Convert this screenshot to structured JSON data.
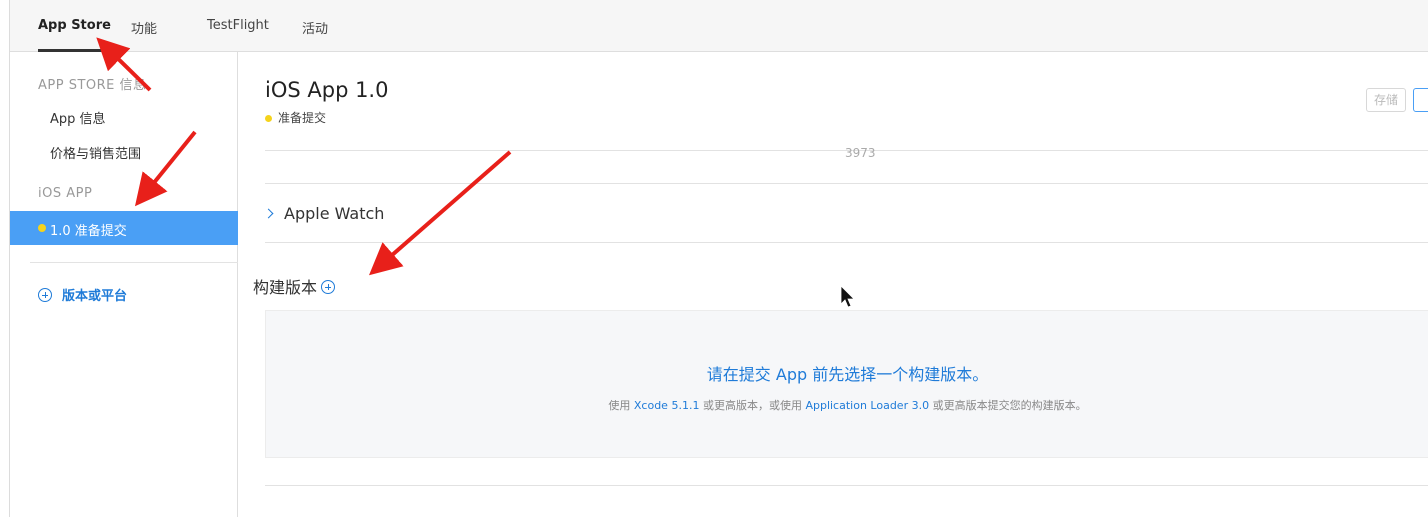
{
  "tabs": {
    "app_store": "App Store",
    "features": "功能",
    "testflight": "TestFlight",
    "activity": "活动"
  },
  "sidebar": {
    "section_app_store": "APP STORE 信息",
    "app_info": "App 信息",
    "pricing": "价格与销售范围",
    "section_ios": "iOS APP",
    "selected_version": "1.0 准备提交",
    "add_version": "版本或平台"
  },
  "main": {
    "title": "iOS App 1.0",
    "status": "准备提交",
    "save_label": "存储",
    "cut_number": "3973",
    "apple_watch": "Apple Watch",
    "build_title": "构建版本",
    "build_headline": "请在提交 App 前先选择一个构建版本。",
    "build_hint_prefix": "使用 ",
    "build_hint_xcode": "Xcode 5.1.1",
    "build_hint_middle": " 或更高版本，或使用 ",
    "build_hint_loader": "Application Loader 3.0",
    "build_hint_suffix": " 或更高版本提交您的构建版本。"
  },
  "colors": {
    "accent": "#1f7bd8",
    "selected_bg": "#4a9ff5",
    "status_dot": "#f5d31c",
    "annotation_arrow": "#e8201a"
  }
}
